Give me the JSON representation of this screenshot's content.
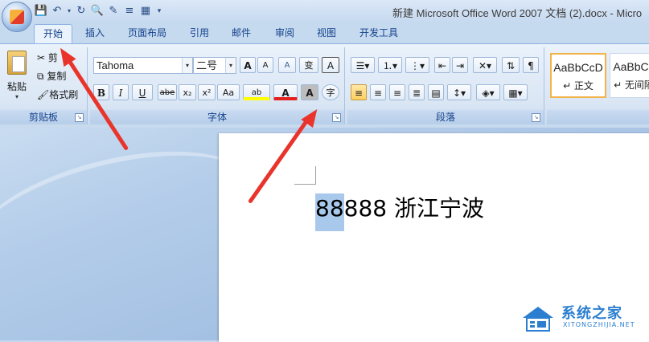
{
  "window": {
    "title": "新建 Microsoft Office Word 2007 文档 (2).docx - Micro"
  },
  "qat": {
    "save_icon": "save-icon",
    "undo_icon": "undo-icon",
    "redo_icon": "redo-icon"
  },
  "tabs": [
    "开始",
    "插入",
    "页面布局",
    "引用",
    "邮件",
    "审阅",
    "视图",
    "开发工具"
  ],
  "clipboard": {
    "paste": "粘贴",
    "cut": "剪",
    "copy": "复制",
    "format_painter": "格式刷",
    "group": "剪贴板"
  },
  "font": {
    "name": "Tahoma",
    "size": "二号",
    "bold": "B",
    "italic": "I",
    "underline": "U",
    "strike": "abe",
    "subscript": "x₂",
    "superscript": "x²",
    "change_case": "Aa",
    "highlight": "ab",
    "font_color": "A",
    "char_shading": "A",
    "enclose": "字",
    "grow": "A",
    "shrink": "A",
    "clear_format": "A",
    "phonetic": "变",
    "border": "A",
    "group": "字体"
  },
  "paragraph": {
    "group": "段落"
  },
  "styles": [
    {
      "preview": "AaBbCcD",
      "name": "↵ 正文"
    },
    {
      "preview": "AaBbCc",
      "name": "↵ 无间隔"
    }
  ],
  "document": {
    "text_highlighted": "88",
    "text_rest": "888 浙江宁波"
  },
  "watermark": {
    "name": "系统之家",
    "url": "XITONGZHIJIA.NET"
  },
  "colors": {
    "accent_red": "#e9342c",
    "highlight": "#a8c8ec"
  }
}
